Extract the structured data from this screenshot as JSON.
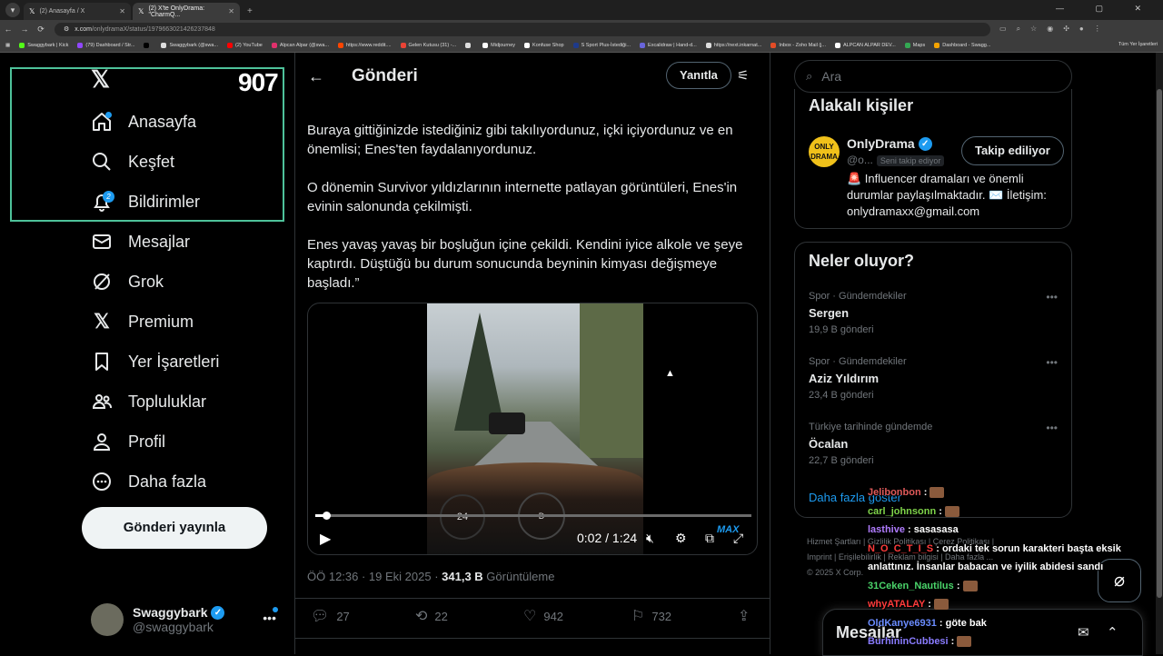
{
  "browser": {
    "tabs": [
      {
        "title": "(2) Anasayfa / X"
      },
      {
        "title": "(2) X'te OnlyDrama: \"CharmQ..."
      }
    ],
    "url_domain": "x.com",
    "url_path": "/onlydramaX/status/1979663021426237848",
    "bookmarks": [
      "Swaggybark | Kick",
      "(79) Dashboard / Str...",
      "",
      "Swaggybark (@swa...",
      "(2) YouTube",
      "Alpcan Alpar (@swa...",
      "https://www.reddit....",
      "Gelen Kutusu (31) -...",
      "",
      "Midjourney",
      "Konfuse Shop",
      "S Sport Plus-İstediği...",
      "Excalidraw | Hand-d...",
      "https://next.inkarnat...",
      "Inbox - Zoho Mail (j...",
      "ALPCAN ALPAR DEV...",
      "Maps",
      "Dashboard - Swagg..."
    ],
    "bookmarks_all": "Tüm Yer İşaretleri"
  },
  "nav": {
    "logo": "𝕏",
    "counter": "907",
    "items": [
      {
        "label": "Anasayfa",
        "icon": "home-icon"
      },
      {
        "label": "Keşfet",
        "icon": "search-icon"
      },
      {
        "label": "Bildirimler",
        "icon": "bell-icon",
        "badge": "2"
      },
      {
        "label": "Mesajlar",
        "icon": "mail-icon"
      },
      {
        "label": "Grok",
        "icon": "grok-icon"
      },
      {
        "label": "Premium",
        "icon": "x-icon"
      },
      {
        "label": "Yer İşaretleri",
        "icon": "bookmark-icon"
      },
      {
        "label": "Topluluklar",
        "icon": "people-icon"
      },
      {
        "label": "Profil",
        "icon": "person-icon"
      },
      {
        "label": "Daha fazla",
        "icon": "more-circle-icon"
      }
    ],
    "post_button": "Gönderi yayınla",
    "account_name": "Swaggybark",
    "account_handle": "@swaggybark"
  },
  "main": {
    "title": "Gönderi",
    "reply_button": "Yanıtla",
    "paragraphs": [
      "Buraya gittiğinizde istediğiniz gibi takılıyordunuz, içki içiyordunuz ve en önemlisi; Enes'ten faydalanıyordunuz.",
      "O dönemin Survivor yıldızlarının internette patlayan görüntüleri, Enes'in evinin salonunda çekilmişti.",
      "Enes yavaş yavaş bir boşluğun içine çekildi. Kendini iyice alkole ve şeye kaptırdı. Düştüğü bu durum sonucunda beyninin kimyası değişmeye başladı.”"
    ],
    "video": {
      "time": "0:02 / 1:24",
      "progress": 0.024,
      "gauge_left": "24",
      "gauge_right": "D",
      "watermark": "MAX"
    },
    "meta_time": "ÖÖ 12:36 · 19 Eki 2025 · ",
    "meta_views": "341,3 B",
    "meta_views_label": " Görüntüleme",
    "actions": {
      "replies": "27",
      "reposts": "22",
      "likes": "942",
      "bookmarks": "732"
    }
  },
  "sidebar": {
    "search_placeholder": "Ara",
    "related_title": "Alakalı kişiler",
    "related": {
      "name": "OnlyDrama",
      "handle": "@o...",
      "follows_you": "Seni takip ediyor",
      "follow_button": "Takip ediliyor",
      "logo_text": "ONLY DRAMA",
      "bio": "🚨 Influencer dramaları ve önemli durumlar paylaşılmaktadır. ✉️ İletişim: onlydramaxx@gmail.com"
    },
    "trends_title": "Neler oluyor?",
    "trends": [
      {
        "category": "Spor · Gündemdekiler",
        "name": "Sergen",
        "count": "19,9 B gönderi"
      },
      {
        "category": "Spor · Gündemdekiler",
        "name": "Aziz Yıldırım",
        "count": "23,4 B gönderi"
      },
      {
        "category": "Türkiye tarihinde gündemde",
        "name": "Öcalan",
        "count": "22,7 B gönderi"
      }
    ],
    "show_more": "Daha fazla göster",
    "footer_line1": "Hizmet Şartları  |  Gizlilik Politikası  |  Çerez Politikası  |",
    "footer_line2": "Imprint  |  Erişilebilirlik  |  Reklam bilgisi  |  Daha fazla ...",
    "footer_line3": "© 2025 X Corp.",
    "messages_title": "Mesajlar"
  },
  "chat": [
    {
      "user": "Jelibonbon",
      "color": "#e05a5a",
      "text": "",
      "emote": true
    },
    {
      "user": "carl_johnsonn",
      "color": "#7fd44a",
      "text": "",
      "emote": true
    },
    {
      "user": "lasthive",
      "color": "#b07cff",
      "text": "sasasasa",
      "emote": false
    },
    {
      "user": "N_O_C_T_I_S",
      "color": "#ff3b3b",
      "text": "ordaki tek sorun karakteri başta eksik",
      "emote": false
    },
    {
      "user": "",
      "color": "#ffffff",
      "text": "anlattınız. İnsanlar babacan ve iyilik abidesi sandı",
      "emote": false
    },
    {
      "user": "31Ceken_Nautilus",
      "color": "#4ad46a",
      "text": "",
      "emote": true
    },
    {
      "user": "whyATALAY",
      "color": "#ff3b3b",
      "text": "",
      "emote": true
    },
    {
      "user": "OldKanye6931",
      "color": "#6a8cff",
      "text": "göte bak",
      "emote": false
    },
    {
      "user": "BurhininCubbesi",
      "color": "#8a7cff",
      "text": "",
      "emote": true
    }
  ]
}
